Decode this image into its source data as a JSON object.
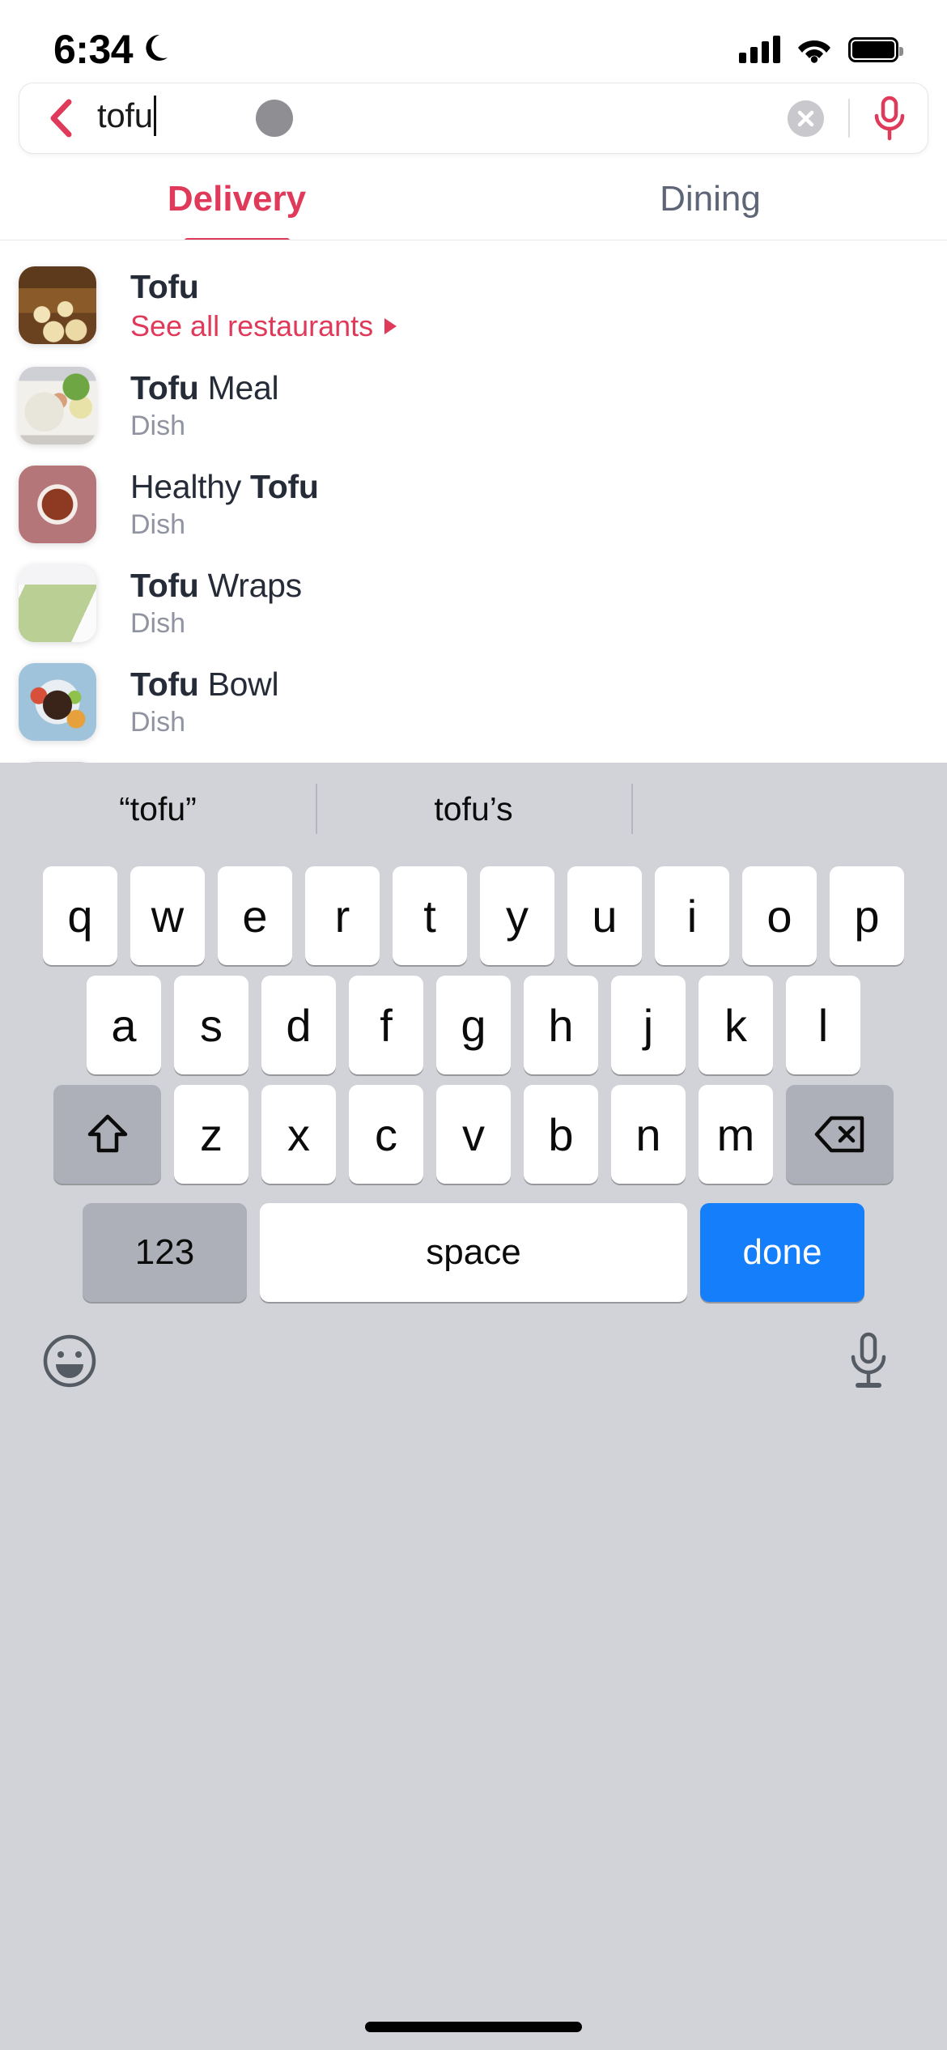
{
  "status_bar": {
    "time": "6:34",
    "moon_icon": "crescent-moon-icon",
    "cell_icon": "cellular-signal-icon",
    "wifi_icon": "wifi-icon",
    "battery_icon": "battery-full-icon"
  },
  "search": {
    "back_icon": "back-chevron-icon",
    "value": "tofu",
    "placeholder": "Search",
    "clear_icon": "clear-circle-icon",
    "mic_icon": "microphone-icon",
    "accent_color": "#e03a5a"
  },
  "tabs": [
    {
      "label": "Delivery",
      "active": true
    },
    {
      "label": "Dining",
      "active": false
    }
  ],
  "results": [
    {
      "title_bold": "Tofu",
      "title_rest": "",
      "subtitle": "See all restaurants",
      "is_link": true,
      "thumb": "dumpling-basket-thumbnail"
    },
    {
      "title_bold": "Tofu",
      "title_rest": " Meal",
      "subtitle": "Dish",
      "is_link": false,
      "thumb": "plated-meal-thumbnail"
    },
    {
      "title_bold": "Tofu",
      "title_rest": "",
      "title_prefix": "Healthy ",
      "subtitle": "Dish",
      "is_link": false,
      "thumb": "mapo-tofu-bowl-thumbnail"
    },
    {
      "title_bold": "Tofu",
      "title_rest": " Wraps",
      "subtitle": "Dish",
      "is_link": false,
      "thumb": "green-wrap-thumbnail"
    },
    {
      "title_bold": "Tofu",
      "title_rest": " Bowl",
      "subtitle": "Dish",
      "is_link": false,
      "thumb": "rice-bowl-thumbnail"
    }
  ],
  "keyboard": {
    "suggestions": [
      "“tofu”",
      "tofu’s",
      ""
    ],
    "row1": [
      "q",
      "w",
      "e",
      "r",
      "t",
      "y",
      "u",
      "i",
      "o",
      "p"
    ],
    "row2": [
      "a",
      "s",
      "d",
      "f",
      "g",
      "h",
      "j",
      "k",
      "l"
    ],
    "row3_letters": [
      "z",
      "x",
      "c",
      "v",
      "b",
      "n",
      "m"
    ],
    "shift_icon": "shift-arrow-icon",
    "backspace_icon": "backspace-delete-icon",
    "numbers_label": "123",
    "space_label": "space",
    "done_label": "done",
    "emoji_icon": "emoji-smiley-icon",
    "dictation_icon": "microphone-dictation-icon"
  }
}
